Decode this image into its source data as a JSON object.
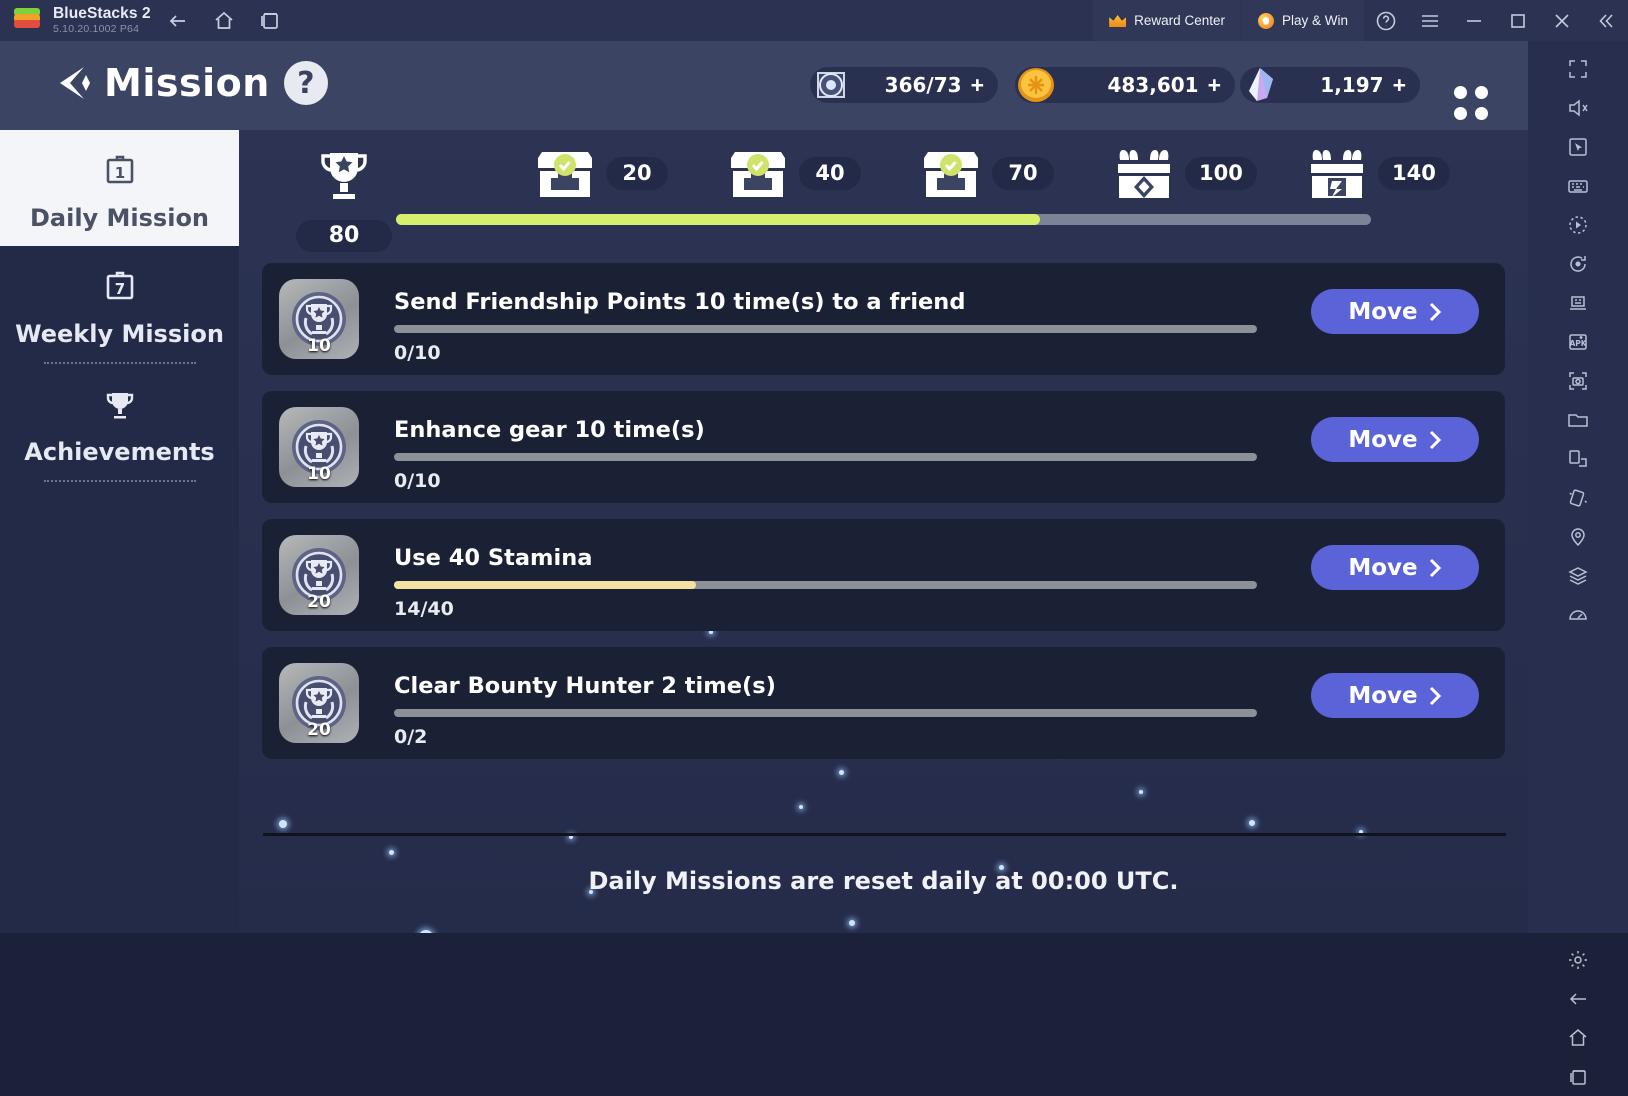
{
  "titlebar": {
    "app_name": "BlueStacks 2",
    "version": "5.10.20.1002  P64",
    "nav": [
      {
        "name": "back-icon",
        "label": "Back"
      },
      {
        "name": "home-icon",
        "label": "Home"
      },
      {
        "name": "recents-icon",
        "label": "Recent apps"
      }
    ],
    "reward_center": "Reward Center",
    "play_and_win": "Play & Win",
    "actions": [
      "help-icon",
      "menu-icon",
      "minimize-icon",
      "maximize-icon",
      "close-icon",
      "collapse-icon"
    ]
  },
  "game": {
    "header": {
      "title": "Mission",
      "help": "?",
      "currencies": [
        {
          "icon": "compass-token-icon",
          "value": "366/73",
          "plus": "+"
        },
        {
          "icon": "gold-coin-icon",
          "value": "483,601",
          "plus": "+"
        },
        {
          "icon": "crystal-gem-icon",
          "value": "1,197",
          "plus": "+"
        }
      ],
      "grid_menu": "grid-menu-icon"
    },
    "sidebar": {
      "items": [
        {
          "label": "Daily Mission",
          "icon": "calendar-1-icon",
          "active": true
        },
        {
          "label": "Weekly Mission",
          "icon": "calendar-7-icon",
          "active": false
        },
        {
          "label": "Achievements",
          "icon": "trophy-icon",
          "active": false
        }
      ]
    },
    "progress": {
      "trophy_total": "80",
      "bar_percent": 66,
      "milestones": [
        {
          "value": "20",
          "claimed": true
        },
        {
          "value": "40",
          "claimed": true
        },
        {
          "value": "70",
          "claimed": true
        },
        {
          "value": "100",
          "claimed": false
        },
        {
          "value": "140",
          "claimed": false
        }
      ]
    },
    "missions": [
      {
        "points": "10",
        "title": "Send Friendship Points 10 time(s) to a friend",
        "progress": "0/10",
        "percent": 0,
        "button": "Move"
      },
      {
        "points": "10",
        "title": "Enhance gear 10 time(s)",
        "progress": "0/10",
        "percent": 0,
        "button": "Move"
      },
      {
        "points": "20",
        "title": "Use 40 Stamina",
        "progress": "14/40",
        "percent": 35,
        "button": "Move"
      },
      {
        "points": "20",
        "title": "Clear Bounty Hunter 2 time(s)",
        "progress": "0/2",
        "percent": 0,
        "button": "Move"
      }
    ],
    "footer_note": "Daily Missions are reset daily at 00:00 UTC."
  },
  "right_toolbar": {
    "items": [
      "fullscreen-icon",
      "mute-icon",
      "cursor-icon",
      "keyboard-icon",
      "macro-play-icon",
      "rotate-sync-icon",
      "multi-instance-icon",
      "install-apk-icon",
      "screenshot-icon",
      "folder-icon",
      "device-rotate-icon",
      "shake-icon",
      "location-icon",
      "layers-icon",
      "performance-icon"
    ],
    "bottom_items": [
      "settings-gear-icon",
      "back-arrow-icon",
      "home-icon",
      "recents-icon"
    ]
  },
  "colors": {
    "accent_blue": "#5a64d8",
    "progress_green": "#d7ef6d",
    "progress_yellow": "#f6e2a0",
    "chrome_bg": "#2b3252",
    "panel_bg": "#1b2134"
  }
}
